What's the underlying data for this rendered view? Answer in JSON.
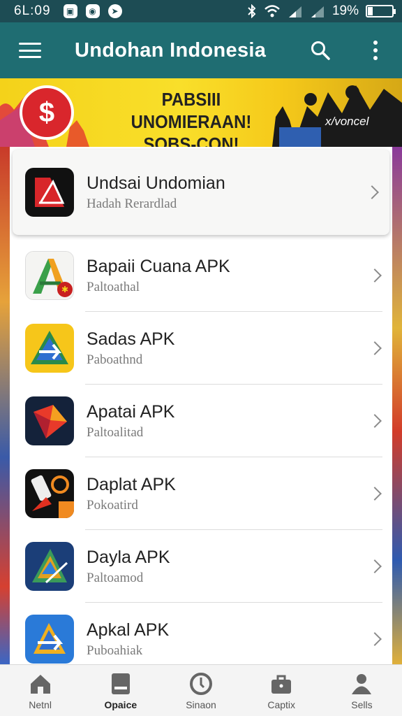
{
  "status_bar": {
    "time": "6L:09",
    "battery": "19%",
    "battery_level": 0.19
  },
  "app_bar": {
    "title": "Undohan Indonesia",
    "menu_icon": "menu-icon",
    "search_icon": "search-icon",
    "more_icon": "more-vert-icon"
  },
  "banner": {
    "logo_glyph": "$",
    "headline_line1": "PABSIII UNOMIERAAN!",
    "headline_line2": "SOBS-CON!",
    "tag": "x/voncel",
    "colors": {
      "background": "#f7d820",
      "logo": "#d9262c"
    }
  },
  "apps": [
    {
      "name": "Undsai Undomian",
      "subtitle": "Hadah Rerardlad",
      "icon": "dark-red-a-icon"
    },
    {
      "name": "Bapaii Cuana APK",
      "subtitle": "Paltoathal",
      "icon": "green-orange-a-icon"
    },
    {
      "name": "Sadas APK",
      "subtitle": "Paboathnd",
      "icon": "yellow-blue-arrow-icon"
    },
    {
      "name": "Apatai APK",
      "subtitle": "Paltoalitad",
      "icon": "red-gem-icon"
    },
    {
      "name": "Daplat APK",
      "subtitle": "Pokoatird",
      "icon": "black-phone-orange-icon"
    },
    {
      "name": "Dayla APK",
      "subtitle": "Paltoamod",
      "icon": "blue-triangle-icon"
    },
    {
      "name": "Apkal APK",
      "subtitle": "Puboahiak",
      "icon": "blue-arrow-icon"
    }
  ],
  "bottom_nav": [
    {
      "label": "Netnl",
      "icon": "home-icon"
    },
    {
      "label": "Opaice",
      "icon": "card-icon",
      "active": true
    },
    {
      "label": "Sinaon",
      "icon": "clock-icon"
    },
    {
      "label": "Captix",
      "icon": "briefcase-icon"
    },
    {
      "label": "Sells",
      "icon": "person-icon"
    }
  ],
  "colors": {
    "status_bar": "#1d4c54",
    "app_bar": "#1f6d72",
    "list_background": "#ffffff"
  }
}
